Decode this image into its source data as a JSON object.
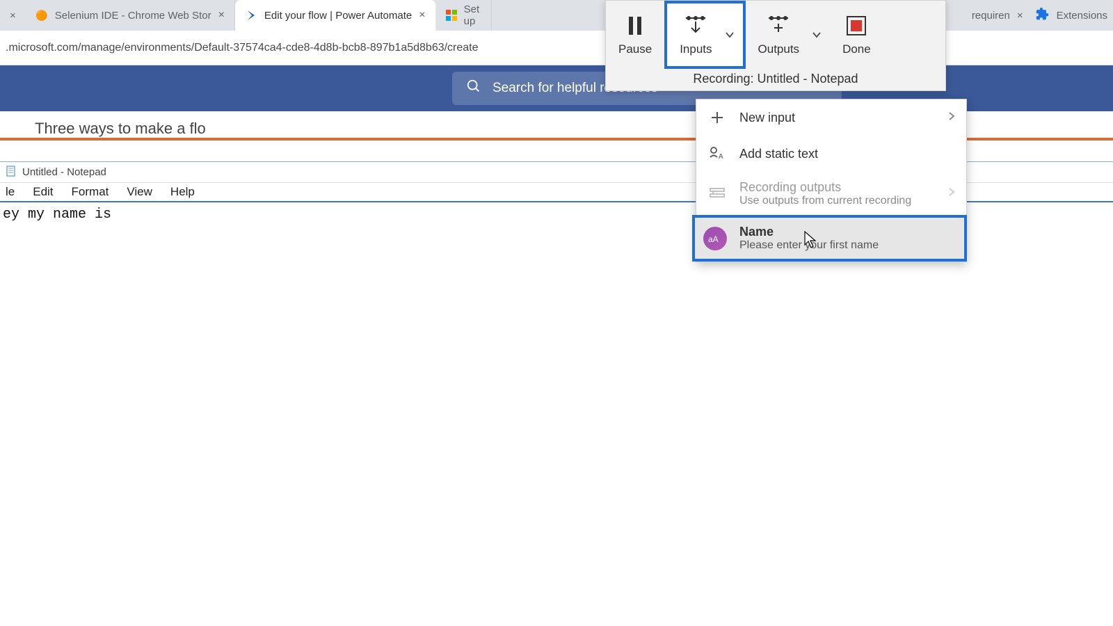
{
  "tabs": {
    "left_partial_close": "×",
    "t1": {
      "label": "Selenium IDE - Chrome Web Stor",
      "close": "×"
    },
    "t2": {
      "label": "Edit your flow | Power Automate",
      "close": "×"
    },
    "t3": {
      "label": "Set up"
    },
    "right_partial": {
      "label": "requiren",
      "close": "×"
    },
    "ext": {
      "label": "Extensions"
    }
  },
  "address_bar": ".microsoft.com/manage/environments/Default-37574ca4-cde8-4d8b-bcb8-897b1a5d8b63/create",
  "search": {
    "placeholder": "Search for helpful resources"
  },
  "page_heading_partial": "Three ways to make a flo",
  "notepad": {
    "title": "Untitled - Notepad",
    "menus": {
      "m0": "le",
      "m1": "Edit",
      "m2": "Format",
      "m3": "View",
      "m4": "Help"
    },
    "body": "ey my name is"
  },
  "recorder": {
    "pause": "Pause",
    "inputs": "Inputs",
    "outputs": "Outputs",
    "done": "Done",
    "status": "Recording: Untitled - Notepad"
  },
  "dropdown": {
    "new_input": "New input",
    "static_text": "Add static text",
    "rec_out_title": "Recording outputs",
    "rec_out_sub": "Use outputs from current recording",
    "name_title": "Name",
    "name_sub": "Please enter your first name"
  }
}
